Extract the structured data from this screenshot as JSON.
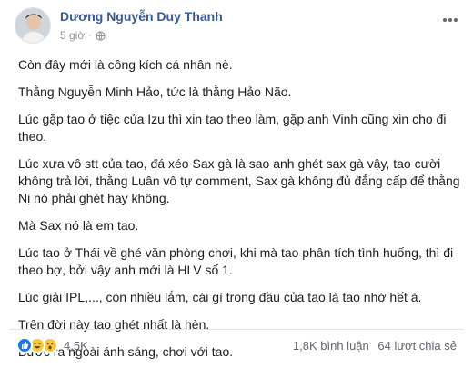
{
  "post": {
    "author": "Dương Nguyễn Duy Thanh",
    "time": "5 giờ",
    "separator": "·",
    "paragraphs": [
      "Còn đây mới là công kích cá nhân nè.",
      "Thằng Nguyễn Minh Hảo, tức là thằng Hảo Não.",
      "Lúc gặp tao ở tiệc của Izu thì xin tao theo làm, gặp anh Vinh cũng xin cho đi theo.",
      "Lúc xưa vô stt của tao, đá xéo Sax gà là sao anh ghét sax gà vậy, tao cười không trả lời, thằng Luân vô tự comment, Sax gà không đủ đẳng cấp để thằng Nị nó phải ghét hay không.",
      "Mà Sax nó là em tao.",
      "Lúc tao ở Thái về ghé văn phòng chơi, khi mà tao phân tích tình huống, thì đi theo bợ, bởi vậy anh mới là HLV số 1.",
      "Lúc giải IPL,..., còn nhiều lắm, cái gì trong đầu của tao là tao nhớ hết à.",
      "Trên đời này tao ghét nhất là hèn.",
      "Bước ra ngoài ánh sáng, chơi với tao."
    ]
  },
  "footer": {
    "reaction_count": "4,5K",
    "comments": "1,8K bình luận",
    "shares": "64 lượt chia sẻ"
  },
  "icons": {
    "more": "more-options-icon",
    "privacy": "globe-icon",
    "reactions": [
      "like-icon",
      "haha-icon",
      "wow-icon"
    ]
  },
  "colors": {
    "author": "#385898",
    "meta": "#90949c",
    "like": "#1877f2",
    "emoji": "#f7c83a"
  }
}
